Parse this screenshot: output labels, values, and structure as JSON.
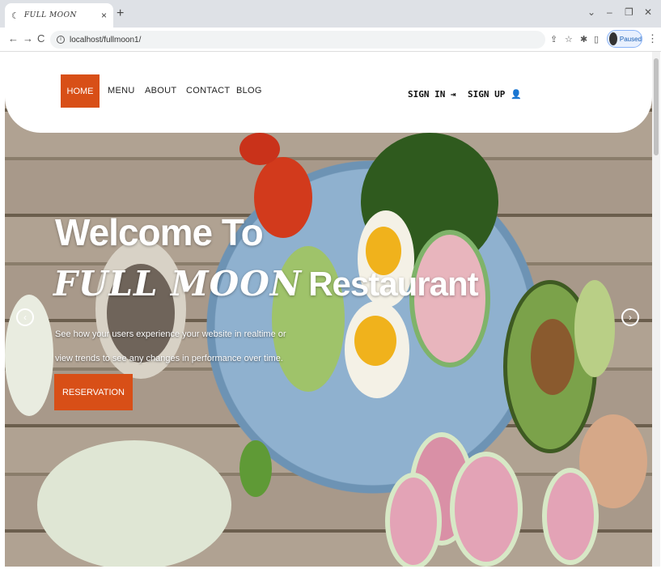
{
  "browser": {
    "tab_title": "FULL MOON",
    "tab_favicon": "☾",
    "tab_close": "×",
    "new_tab": "+",
    "window_controls": [
      "⌄",
      "–",
      "❐",
      "✕"
    ],
    "url": "localhost/fullmoon1/",
    "nav": {
      "back": "←",
      "forward": "→",
      "reload": "C"
    },
    "toolbar_icons": [
      "share-icon",
      "star-icon",
      "extensions-icon",
      "sidepanel-icon"
    ],
    "profile_status": "Paused"
  },
  "header": {
    "nav_items": [
      {
        "label": "HOME",
        "active": true
      },
      {
        "label": "MENU"
      },
      {
        "label": "ABOUT"
      },
      {
        "label": "CONTACT"
      },
      {
        "label": "BLOG"
      }
    ],
    "sign_in": "SIGN IN",
    "sign_up": "SIGN UP"
  },
  "hero": {
    "title_line1": "Welcome To",
    "title_brand": "FULL MOON",
    "title_rest": "Restaurant",
    "subtitle": "See how your users experience your website in realtime or view trends to see any changes in performance over time.",
    "cta": "RESERVATION",
    "prev_arrow": "‹",
    "next_arrow": "›"
  },
  "colors": {
    "accent": "#d84f17",
    "header_bg": "#ffffff"
  }
}
